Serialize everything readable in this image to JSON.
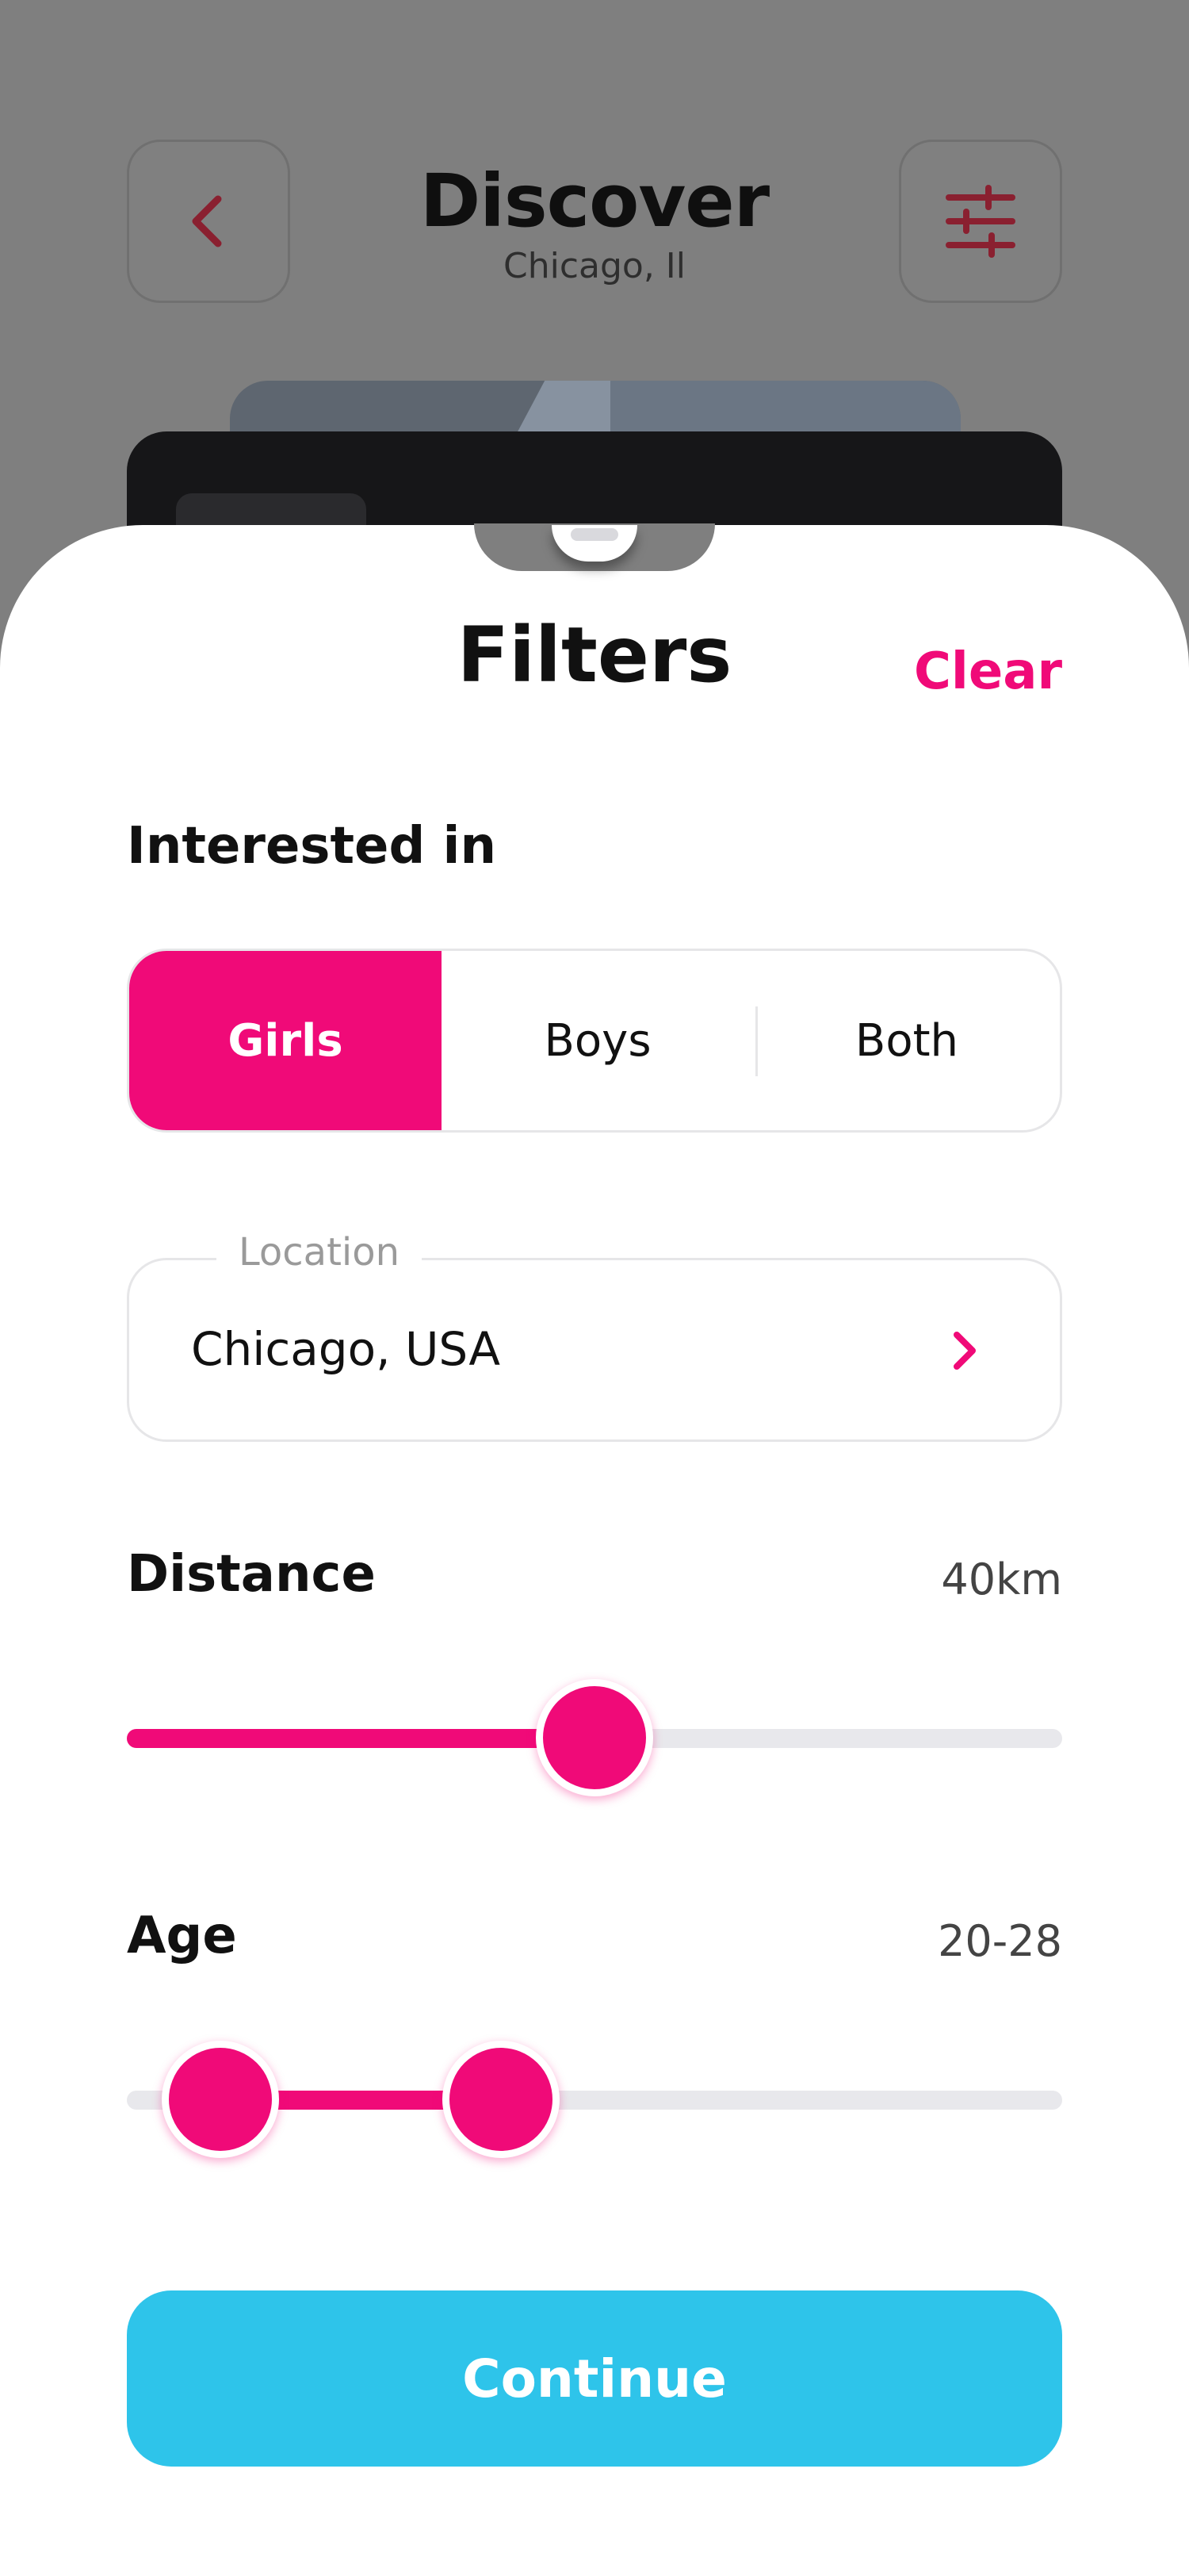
{
  "background": {
    "title": "Discover",
    "subtitle": "Chicago, Il",
    "back_icon": "chevron-left-icon",
    "filter_icon": "sliders-icon"
  },
  "filters": {
    "title": "Filters",
    "clear_label": "Clear",
    "interested_in": {
      "label": "Interested in",
      "options": [
        "Girls",
        "Boys",
        "Both"
      ],
      "selected": "Girls"
    },
    "location": {
      "label": "Location",
      "value": "Chicago, USA",
      "icon": "chevron-right-icon"
    },
    "distance": {
      "label": "Distance",
      "value_text": "40km",
      "fraction": 0.5
    },
    "age": {
      "label": "Age",
      "value_text": "20-28",
      "low_fraction": 0.1,
      "high_fraction": 0.4
    },
    "continue_label": "Continue"
  },
  "colors": {
    "accent": "#f00a78",
    "primary_button": "#2ec4ea",
    "overlay": "#7f7f7f"
  }
}
